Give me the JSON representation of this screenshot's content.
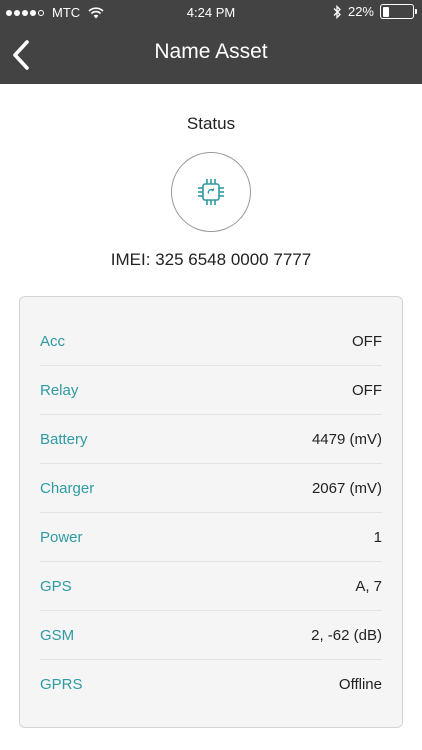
{
  "status_bar": {
    "carrier": "MTC",
    "time": "4:24 PM",
    "battery_text": "22%",
    "battery_level": 0.22,
    "signal_bars": 4
  },
  "nav": {
    "title": "Name Asset",
    "back_icon": "chevron-left-icon"
  },
  "status": {
    "label": "Status",
    "icon": "chip-icon",
    "icon_color": "#2e9aa3",
    "imei_text": "IMEI:  325 6548 0000 7777"
  },
  "details": [
    {
      "label": "Acc",
      "value": "OFF"
    },
    {
      "label": "Relay",
      "value": "OFF"
    },
    {
      "label": "Battery",
      "value": "4479 (mV)"
    },
    {
      "label": "Charger",
      "value": "2067 (mV)"
    },
    {
      "label": "Power",
      "value": "1"
    },
    {
      "label": "GPS",
      "value": "A, 7"
    },
    {
      "label": "GSM",
      "value": "2, -62 (dB)"
    },
    {
      "label": "GPRS",
      "value": "Offline"
    }
  ],
  "colors": {
    "header_bg": "#434343",
    "label_accent": "#2e9aa3"
  }
}
